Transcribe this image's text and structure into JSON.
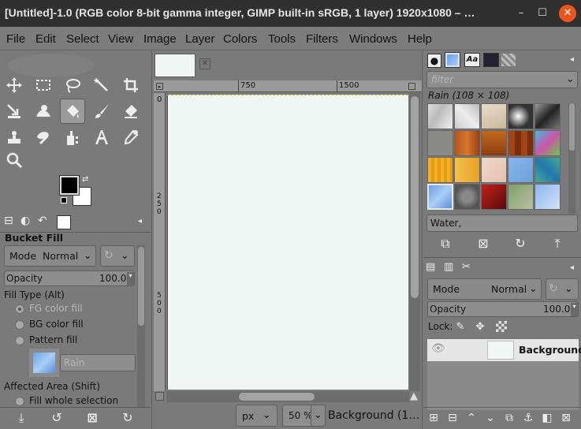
{
  "window": {
    "title": "[Untitled]-1.0 (RGB color 8-bit gamma integer, GIMP built-in sRGB, 1 layer) 1920x1080 – …",
    "minimize": "–",
    "maximize": "☐",
    "close": "✕"
  },
  "menu": [
    "File",
    "Edit",
    "Select",
    "View",
    "Image",
    "Layer",
    "Colors",
    "Tools",
    "Filters",
    "Windows",
    "Help"
  ],
  "tool_options": {
    "title": "Bucket Fill",
    "mode_label": "Mode",
    "mode_value": "Normal",
    "opacity_label": "Opacity",
    "opacity_value": "100.0",
    "fill_type_label": "Fill Type  (Alt)",
    "fill_options": [
      "FG color fill",
      "BG color fill",
      "Pattern fill"
    ],
    "fill_selected": "FG color fill",
    "pattern_name": "Rain",
    "affected_label": "Affected Area  (Shift)",
    "affected_option": "Fill whole selection"
  },
  "canvas": {
    "ruler_h": [
      "750",
      "1500"
    ],
    "ruler_v": [
      "0",
      "250",
      "500"
    ],
    "unit": "px",
    "zoom": "50 %",
    "status": "Background (1…"
  },
  "patterns": {
    "filter_placeholder": "filter",
    "selected_label": "Rain (108 × 108)",
    "name_field": "Water,"
  },
  "layers": {
    "mode_label": "Mode",
    "mode_value": "Normal",
    "opacity_label": "Opacity",
    "opacity_value": "100.0",
    "lock_label": "Lock:",
    "layer_name": "Background"
  },
  "colors": {
    "fg": "#000000",
    "bg": "#ffffff",
    "canvas": "#f1f7f4",
    "accent": "#e95420"
  }
}
